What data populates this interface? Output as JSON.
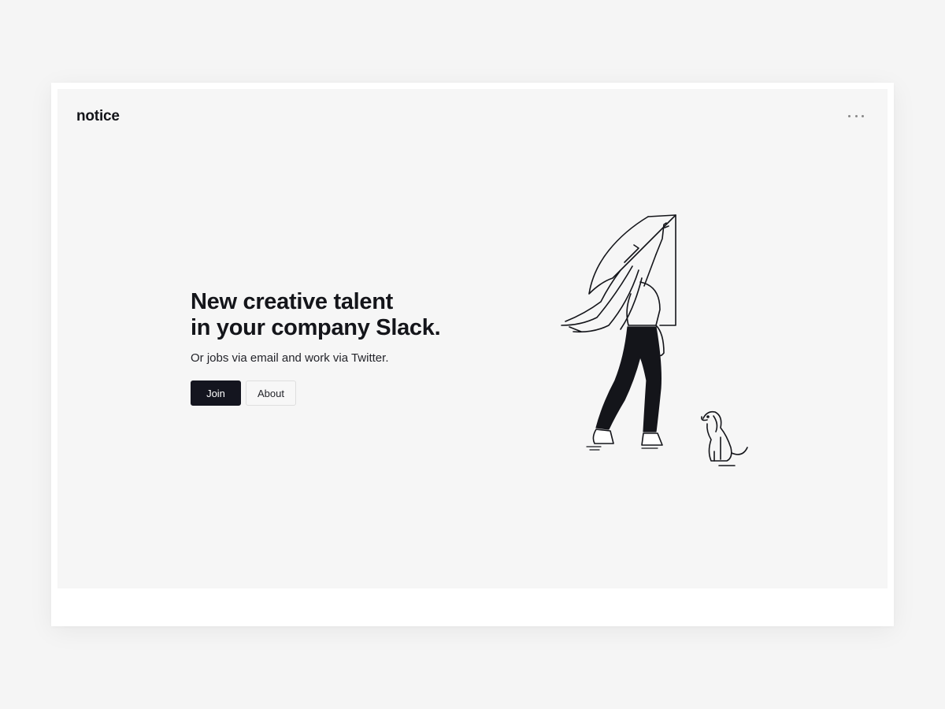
{
  "header": {
    "logo": "notice",
    "menu_icon": "more-horizontal-icon"
  },
  "hero": {
    "headline_line1": "New creative talent",
    "headline_line2": "in your company Slack.",
    "subtitle": "Or jobs via email and work via Twitter.",
    "join_label": "Join",
    "about_label": "About"
  },
  "illustration": {
    "subject": "woman-hanging-poster-with-dog"
  },
  "colors": {
    "background": "#f6f6f6",
    "primary_button": "#14151f",
    "text": "#14151a"
  }
}
